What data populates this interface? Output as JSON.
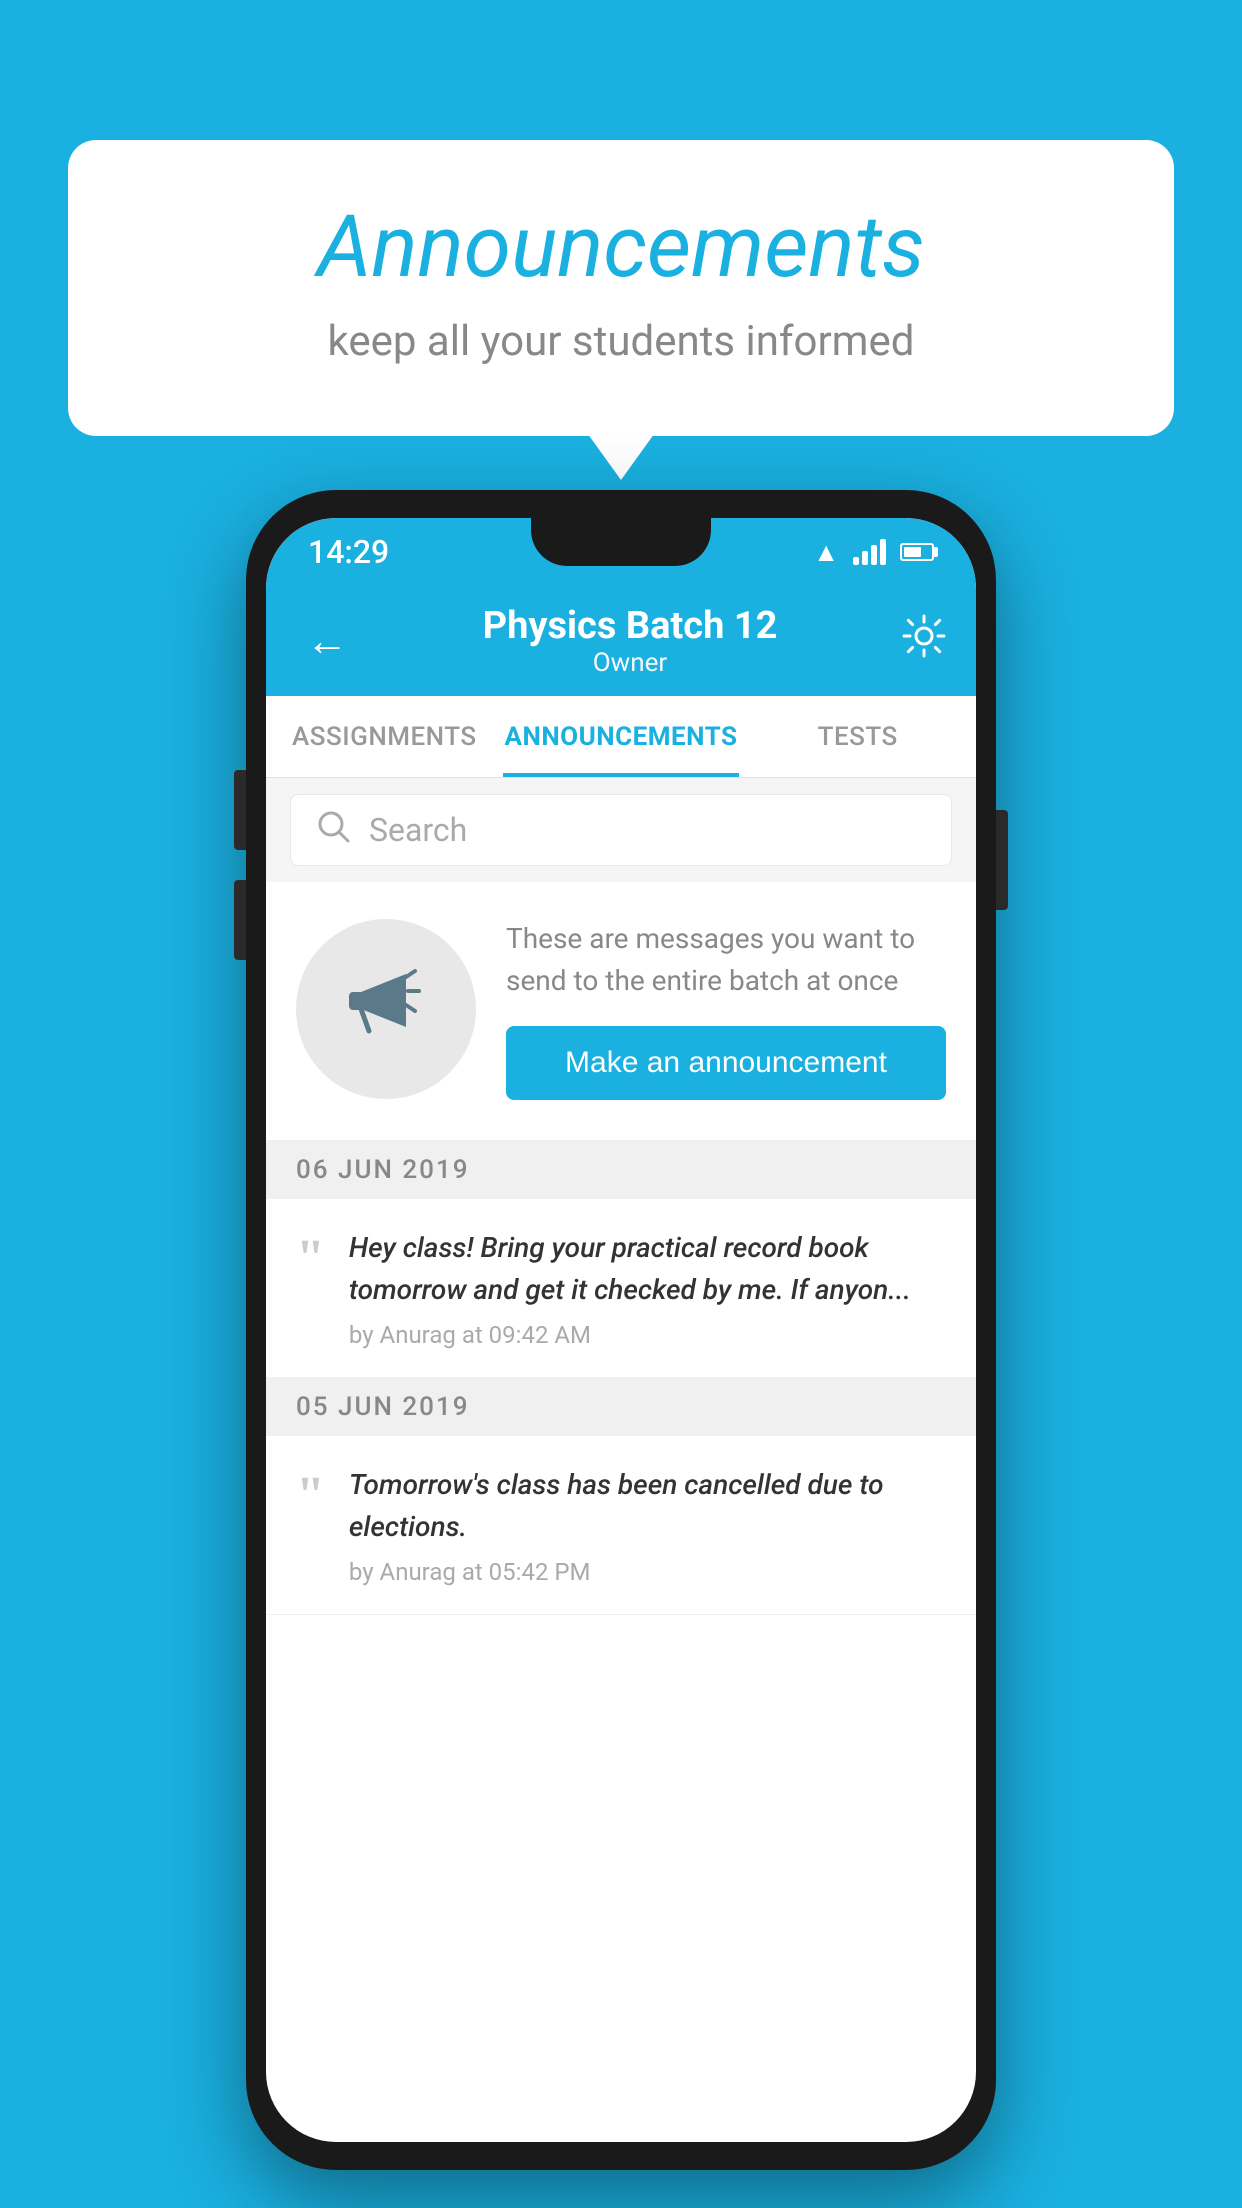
{
  "background_color": "#1ab0e0",
  "speech_bubble": {
    "title": "Announcements",
    "subtitle": "keep all your students informed"
  },
  "phone": {
    "status_bar": {
      "time": "14:29"
    },
    "header": {
      "title": "Physics Batch 12",
      "subtitle": "Owner",
      "back_label": "←",
      "settings_label": "⚙"
    },
    "tabs": [
      {
        "label": "ASSIGNMENTS",
        "active": false
      },
      {
        "label": "ANNOUNCEMENTS",
        "active": true
      },
      {
        "label": "TESTS",
        "active": false
      }
    ],
    "search": {
      "placeholder": "Search"
    },
    "promo": {
      "description": "These are messages you want to send to the entire batch at once",
      "button_label": "Make an announcement"
    },
    "announcements": [
      {
        "date": "06  JUN  2019",
        "items": [
          {
            "text": "Hey class! Bring your practical record book tomorrow and get it checked by me. If anyon...",
            "meta": "by Anurag at 09:42 AM"
          }
        ]
      },
      {
        "date": "05  JUN  2019",
        "items": [
          {
            "text": "Tomorrow's class has been cancelled due to elections.",
            "meta": "by Anurag at 05:42 PM"
          }
        ]
      }
    ]
  }
}
